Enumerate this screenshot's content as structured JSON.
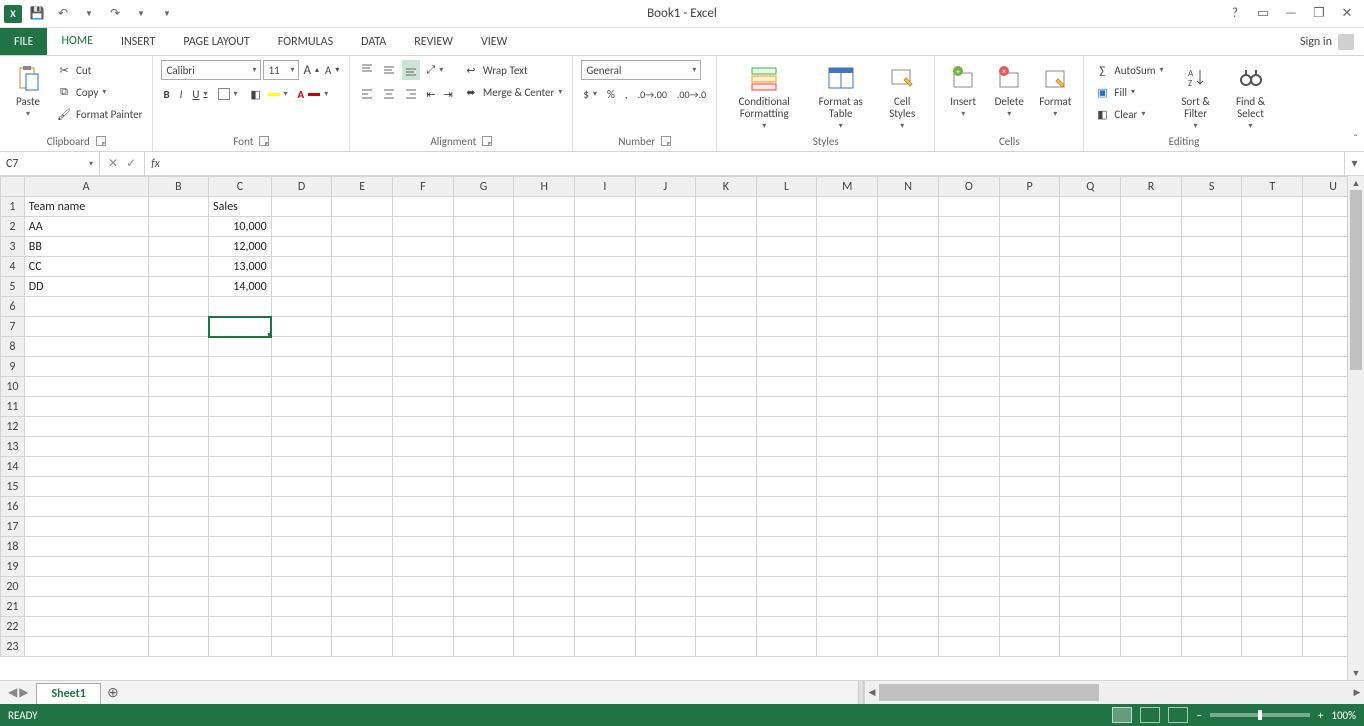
{
  "title": "Book1 - Excel",
  "qat": {
    "save": "💾",
    "undo": "↶",
    "redo": "↷"
  },
  "window": {
    "help": "?",
    "ribbon_opts": "▭",
    "min": "—",
    "max": "❐",
    "close": "✕"
  },
  "tabs": {
    "file": "FILE",
    "home": "HOME",
    "insert": "INSERT",
    "page_layout": "PAGE LAYOUT",
    "formulas": "FORMULAS",
    "data": "DATA",
    "review": "REVIEW",
    "view": "VIEW",
    "signin": "Sign in"
  },
  "ribbon": {
    "clipboard": {
      "label": "Clipboard",
      "paste": "Paste",
      "cut": "Cut",
      "copy": "Copy",
      "painter": "Format Painter"
    },
    "font": {
      "label": "Font",
      "name": "Calibri",
      "size": "11",
      "bold": "B",
      "italic": "I",
      "underline": "U"
    },
    "alignment": {
      "label": "Alignment",
      "wrap": "Wrap Text",
      "merge": "Merge & Center"
    },
    "number": {
      "label": "Number",
      "format": "General"
    },
    "styles": {
      "label": "Styles",
      "cond": "Conditional Formatting",
      "table": "Format as Table",
      "cell": "Cell Styles"
    },
    "cells": {
      "label": "Cells",
      "insert": "Insert",
      "delete": "Delete",
      "format": "Format"
    },
    "editing": {
      "label": "Editing",
      "autosum": "AutoSum",
      "fill": "Fill",
      "clear": "Clear",
      "sort": "Sort & Filter",
      "find": "Find & Select"
    }
  },
  "namebox": "C7",
  "formula": "",
  "columns": [
    "A",
    "B",
    "C",
    "D",
    "E",
    "F",
    "G",
    "H",
    "I",
    "J",
    "K",
    "L",
    "M",
    "N",
    "O",
    "P",
    "Q",
    "R",
    "S",
    "T",
    "U"
  ],
  "rows": 23,
  "selected": {
    "row": 7,
    "col": "C"
  },
  "cells": {
    "A1": "Team name",
    "C1": "Sales",
    "A2": "AA",
    "C2": "10,000",
    "A3": "BB",
    "C3": "12,000",
    "A4": "CC",
    "C4": "13,000",
    "A5": "DD",
    "C5": "14,000"
  },
  "sheet_tab": "Sheet1",
  "status": {
    "ready": "READY",
    "zoom": "100%"
  }
}
